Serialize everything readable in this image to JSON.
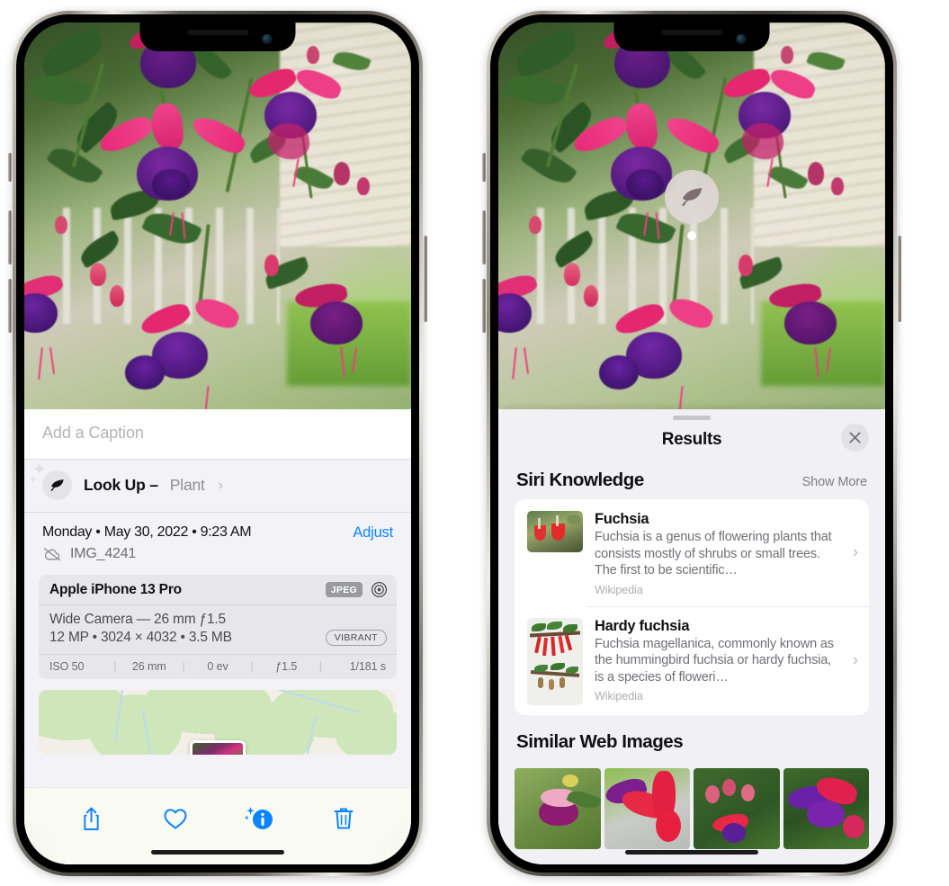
{
  "left_phone": {
    "caption": {
      "placeholder": "Add a Caption"
    },
    "lookup": {
      "title": "Look Up –",
      "subject": "Plant",
      "chevron": "›",
      "icon": "leaf-icon"
    },
    "date_line": "Monday • May 30, 2022 • 9:23 AM",
    "adjust_label": "Adjust",
    "file_name": "IMG_4241",
    "cloud_icon": "cloud-slash-icon",
    "exif": {
      "device": "Apple iPhone 13 Pro",
      "format_badge": "JPEG",
      "aperture_icon": "aperture-icon",
      "lens": "Wide Camera — 26 mm ƒ1.5",
      "size_line": "12 MP • 3024 × 4032 • 3.5 MB",
      "style_badge": "VIBRANT",
      "stats": [
        "ISO 50",
        "26 mm",
        "0 ev",
        "ƒ1.5",
        "1/181 s"
      ]
    },
    "toolbar": [
      {
        "name": "share-button",
        "icon": "share-icon"
      },
      {
        "name": "favorite-button",
        "icon": "heart-icon"
      },
      {
        "name": "info-button",
        "icon": "info-sparkle-icon"
      },
      {
        "name": "delete-button",
        "icon": "trash-icon"
      }
    ],
    "accent_color": "#0a84ff"
  },
  "right_phone": {
    "visual_lookup_badge": {
      "icon": "leaf-icon"
    },
    "sheet": {
      "title": "Results",
      "close_icon": "close-icon",
      "sections": [
        {
          "title": "Siri Knowledge",
          "action": "Show More",
          "items": [
            {
              "name": "Fuchsia",
              "description": "Fuchsia is a genus of flowering plants that consists mostly of shrubs or small trees. The first to be scientific…",
              "source": "Wikipedia",
              "chevron": "›"
            },
            {
              "name": "Hardy fuchsia",
              "description": "Fuchsia magellanica, commonly known as the hummingbird fuchsia or hardy fuchsia, is a species of floweri…",
              "source": "Wikipedia",
              "chevron": "›"
            }
          ]
        },
        {
          "title": "Similar Web Images",
          "items_count": 4
        }
      ]
    }
  }
}
